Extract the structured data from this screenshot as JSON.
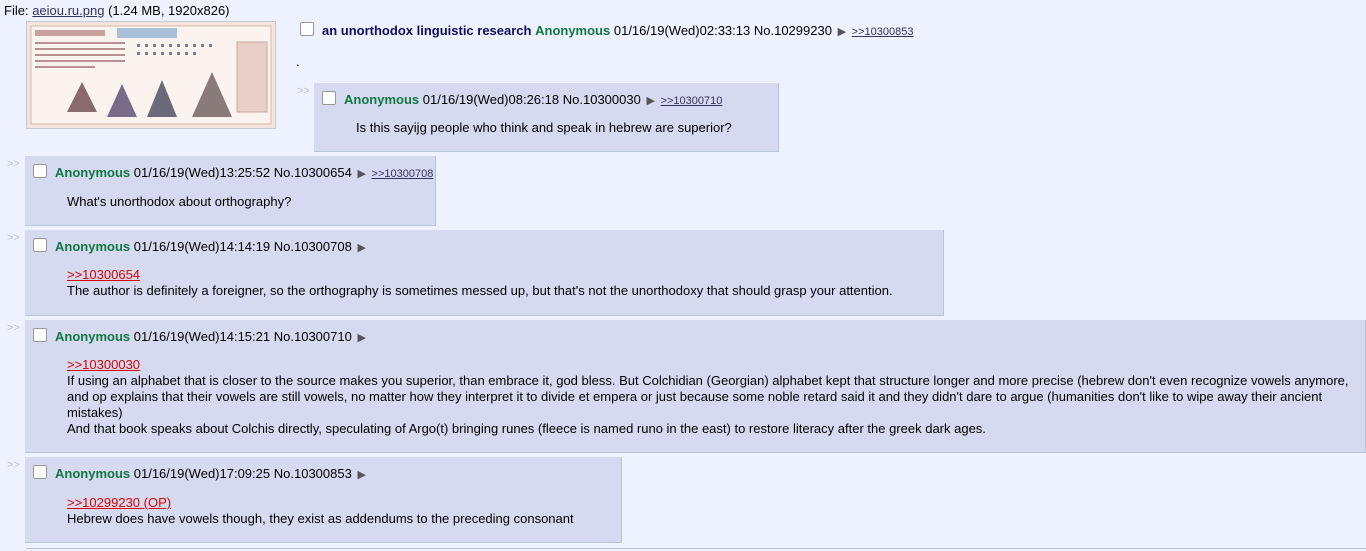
{
  "file": {
    "label": "File:",
    "name": "aeiou.ru.png",
    "info": "(1.24 MB, 1920x826)"
  },
  "op": {
    "subject": "an unorthodox linguistic research",
    "name": "Anonymous",
    "datetime": "01/16/19(Wed)02:33:13",
    "no": "No.10299230",
    "arrow": "▶",
    "backlinks": [
      ">>10300853"
    ],
    "body": "."
  },
  "side_marker": ">>",
  "replies": [
    {
      "name": "Anonymous",
      "datetime": "01/16/19(Wed)08:26:18",
      "no": "No.10300030",
      "arrow": "▶",
      "backlinks": [
        ">>10300710"
      ],
      "quote": "",
      "lines": [
        "Is this sayijg people who think and speak in hebrew are superior?"
      ]
    },
    {
      "name": "Anonymous",
      "datetime": "01/16/19(Wed)13:25:52",
      "no": "No.10300654",
      "arrow": "▶",
      "backlinks": [
        ">>10300708"
      ],
      "quote": "",
      "lines": [
        "What's unorthodox about orthography?"
      ]
    },
    {
      "name": "Anonymous",
      "datetime": "01/16/19(Wed)14:14:19",
      "no": "No.10300708",
      "arrow": "▶",
      "backlinks": [],
      "quote": ">>10300654",
      "lines": [
        "The author is definitely a foreigner, so the orthography is sometimes messed up, but that's not the unorthodoxy that should grasp your attention."
      ]
    },
    {
      "name": "Anonymous",
      "datetime": "01/16/19(Wed)14:15:21",
      "no": "No.10300710",
      "arrow": "▶",
      "backlinks": [],
      "quote": ">>10300030",
      "lines": [
        "If using an alphabet that is closer to the source makes you superior, than embrace it, god bless. But Colchidian (Georgian) alphabet kept that structure longer and more precise (hebrew don't even recognize vowels anymore,",
        "and op explains that their vowels are still vowels, no matter how they interpret it to divide et empera or just because some noble retard said it and they didn't dare to argue (humanities don't like to wipe away their ancient",
        "mistakes)",
        "And that book speaks about Colchis directly, speculating of Argo(t) bringing runes (fleece is named runo in the east) to restore literacy after the greek dark ages."
      ]
    },
    {
      "name": "Anonymous",
      "datetime": "01/16/19(Wed)17:09:25",
      "no": "No.10300853",
      "arrow": "▶",
      "backlinks": [],
      "quote": ">>10299230 (OP)",
      "lines": [
        "Hebrew does have vowels though, they exist as addendums to the preceding consonant"
      ]
    }
  ]
}
